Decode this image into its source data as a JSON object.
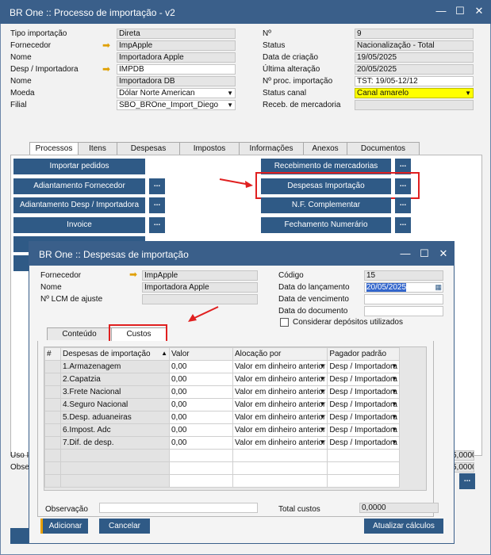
{
  "window": {
    "title": "BR One :: Processo de importação - v2"
  },
  "header_left": [
    {
      "label": "Tipo importação",
      "value": "Direta"
    },
    {
      "label": "Fornecedor",
      "value": "ImpApple"
    },
    {
      "label": "Nome",
      "value": "Importadora Apple"
    },
    {
      "label": "Desp / Importadora",
      "value": "IMPDB"
    },
    {
      "label": "Nome",
      "value": "Importadora DB"
    },
    {
      "label": "Moeda",
      "value": "Dólar Norte American"
    },
    {
      "label": "Filial",
      "value": "SBO_BROne_Import_Diego"
    }
  ],
  "header_right": [
    {
      "label": "Nº",
      "value": "9"
    },
    {
      "label": "Status",
      "value": "Nacionalização - Total"
    },
    {
      "label": "Data de criação",
      "value": "19/05/2025"
    },
    {
      "label": "Última alteração",
      "value": "20/05/2025"
    },
    {
      "label": "Nº proc. importação",
      "value": "TST: 19/05-12/12"
    },
    {
      "label": "Status canal",
      "value": "Canal amarelo"
    },
    {
      "label": "Receb. de mercadoria",
      "value": ""
    }
  ],
  "tabs": [
    "Processos",
    "Itens",
    "Despesas",
    "Impostos",
    "Informações",
    "Anexos",
    "Documentos"
  ],
  "left_buttons": [
    "Importar pedidos",
    "Adiantamento Fornecedor",
    "Adiantamento Desp / Importadora",
    "Invoice"
  ],
  "right_buttons": [
    "Recebimento de mercadorias",
    "Despesas Importação",
    "N.F. Complementar",
    "Fechamento Numerário"
  ],
  "more_label": "...",
  "bg_bottom": {
    "uso_label": "Uso I",
    "obs_label": "Obse",
    "val1": "5,0000",
    "val2": "5,0000"
  },
  "dialog": {
    "title": "BR One :: Despesas de importação",
    "fornecedor_label": "Fornecedor",
    "fornecedor_value": "ImpApple",
    "nome_label": "Nome",
    "nome_value": "Importadora Apple",
    "lcm_label": "Nº LCM de ajuste",
    "lcm_value": "",
    "codigo_label": "Código",
    "codigo_value": "15",
    "data_lanc_label": "Data do lançamento",
    "data_lanc_value": "20/05/2025",
    "data_venc_label": "Data de vencimento",
    "data_doc_label": "Data do documento",
    "considerar_label": "Considerar depósitos utilizados",
    "tabs": [
      "Conteúdo",
      "Custos"
    ],
    "columns": [
      "#",
      "Despesas de importação",
      "Valor",
      "Alocação por",
      "Pagador padrão"
    ],
    "rows": [
      {
        "name": "1.Armazenagem",
        "valor": "0,00",
        "alocacao": "Valor em dinheiro anterior",
        "pagador": "Desp / Importadora"
      },
      {
        "name": "2.Capatzia",
        "valor": "0,00",
        "alocacao": "Valor em dinheiro anterior",
        "pagador": "Desp / Importadora"
      },
      {
        "name": "3.Frete Nacional",
        "valor": "0,00",
        "alocacao": "Valor em dinheiro anterior",
        "pagador": "Desp / Importadora"
      },
      {
        "name": "4.Seguro Nacional",
        "valor": "0,00",
        "alocacao": "Valor em dinheiro anterior",
        "pagador": "Desp / Importadora"
      },
      {
        "name": "5.Desp. aduaneiras",
        "valor": "0,00",
        "alocacao": "Valor em dinheiro anterior",
        "pagador": "Desp / Importadora"
      },
      {
        "name": "6.Impost. Adc",
        "valor": "0,00",
        "alocacao": "Valor em dinheiro anterior",
        "pagador": "Desp / Importadora"
      },
      {
        "name": "7.Dif. de desp.",
        "valor": "0,00",
        "alocacao": "Valor em dinheiro anterior",
        "pagador": "Desp / Importadora"
      }
    ],
    "observacao_label": "Observação",
    "total_label": "Total custos",
    "total_value": "0,0000",
    "btn_add": "Adicionar",
    "btn_cancel": "Cancelar",
    "btn_update": "Atualizar cálculos"
  },
  "colors": {
    "titlebar": "#3a5f8a",
    "button": "#2f5a86",
    "highlight": "#ffff00",
    "annotation": "#e02020"
  }
}
